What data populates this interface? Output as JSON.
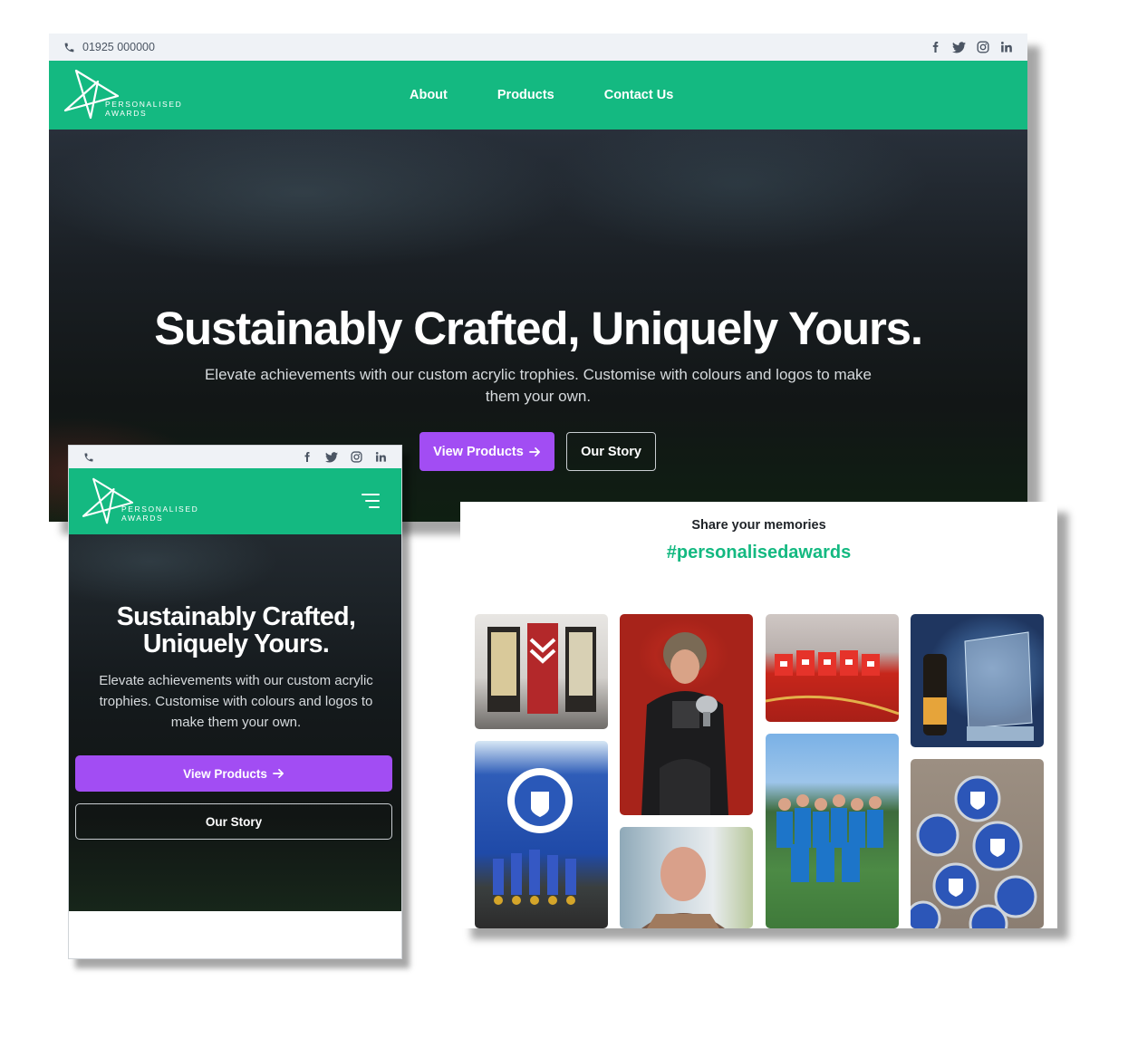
{
  "desktop": {
    "phone": "01925 000000",
    "logo_line1": "PERSONALISED",
    "logo_line2": "AWARDS",
    "nav": [
      "About",
      "Products",
      "Contact Us"
    ],
    "hero_title": "Sustainably Crafted, Uniquely Yours.",
    "hero_text": "Elevate achievements with our custom acrylic trophies. Customise with colours and logos to make them your own.",
    "cta_primary": "View Products",
    "cta_secondary": "Our Story"
  },
  "mobile": {
    "logo_line1": "PERSONALISED",
    "logo_line2": "AWARDS",
    "hero_title_line1": "Sustainably Crafted,",
    "hero_title_line2": "Uniquely Yours.",
    "hero_text": "Elevate achievements with our custom acrylic trophies. Customise with colours and logos to make them your own.",
    "cta_primary": "View Products",
    "cta_secondary": "Our Story"
  },
  "social_wall": {
    "heading": "Share your memories",
    "hashtag": "#personalisedawards"
  },
  "colors": {
    "brand_green": "#14b981",
    "button_purple": "#a24df3",
    "topbar_bg": "#eff2f6"
  },
  "icons": [
    "phone-icon",
    "facebook-icon",
    "twitter-icon",
    "instagram-icon",
    "linkedin-icon",
    "star-logo-icon",
    "menu-icon",
    "arrow-right-icon"
  ]
}
